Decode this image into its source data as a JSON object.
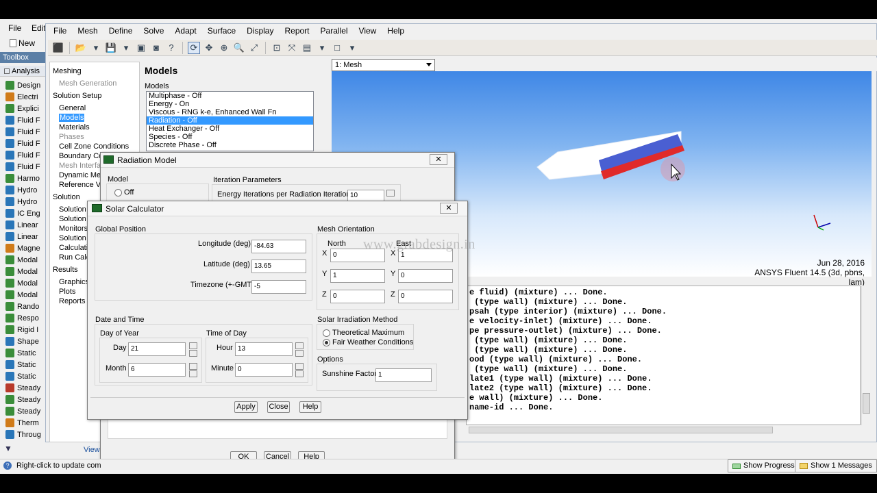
{
  "workbench": {
    "menu": [
      "File",
      "Edit"
    ],
    "new_label": "New",
    "toolbox_label": "Toolbox",
    "analysis_label": "Analysis",
    "toolbox_items": [
      {
        "label": "Design",
        "color": "#3a8d3a"
      },
      {
        "label": "Electri",
        "color": "#d07b1a"
      },
      {
        "label": "Explici",
        "color": "#3a8d3a"
      },
      {
        "label": "Fluid F",
        "color": "#2a76b8"
      },
      {
        "label": "Fluid F",
        "color": "#2a76b8"
      },
      {
        "label": "Fluid F",
        "color": "#2a76b8"
      },
      {
        "label": "Fluid F",
        "color": "#2a76b8"
      },
      {
        "label": "Fluid F",
        "color": "#2a76b8"
      },
      {
        "label": "Harmo",
        "color": "#3a8d3a"
      },
      {
        "label": "Hydro",
        "color": "#2a76b8"
      },
      {
        "label": "Hydro",
        "color": "#2a76b8"
      },
      {
        "label": "IC Eng",
        "color": "#2a76b8"
      },
      {
        "label": "Linear",
        "color": "#2a76b8"
      },
      {
        "label": "Linear",
        "color": "#2a76b8"
      },
      {
        "label": "Magne",
        "color": "#d07b1a"
      },
      {
        "label": "Modal",
        "color": "#3a8d3a"
      },
      {
        "label": "Modal",
        "color": "#3a8d3a"
      },
      {
        "label": "Modal",
        "color": "#3a8d3a"
      },
      {
        "label": "Modal",
        "color": "#3a8d3a"
      },
      {
        "label": "Rando",
        "color": "#3a8d3a"
      },
      {
        "label": "Respo",
        "color": "#3a8d3a"
      },
      {
        "label": "Rigid I",
        "color": "#3a8d3a"
      },
      {
        "label": "Shape",
        "color": "#2a76b8"
      },
      {
        "label": "Static",
        "color": "#3a8d3a"
      },
      {
        "label": "Static",
        "color": "#2a76b8"
      },
      {
        "label": "Static",
        "color": "#2a76b8"
      },
      {
        "label": "Steady",
        "color": "#b83a2a"
      },
      {
        "label": "Steady",
        "color": "#3a8d3a"
      },
      {
        "label": "Steady",
        "color": "#3a8d3a"
      },
      {
        "label": "Therm",
        "color": "#d07b1a"
      },
      {
        "label": "Throug",
        "color": "#2a76b8"
      }
    ],
    "view_link": "View",
    "status_text": "Right-click to update com",
    "show_progress": "Show Progress",
    "show_messages": "Show 1 Messages"
  },
  "fluent": {
    "menu": [
      "File",
      "Mesh",
      "Define",
      "Solve",
      "Adapt",
      "Surface",
      "Display",
      "Report",
      "Parallel",
      "View",
      "Help"
    ],
    "nav": {
      "meshing": "Meshing",
      "mesh_generation": "Mesh Generation",
      "solution_setup": "Solution Setup",
      "general": "General",
      "models": "Models",
      "materials": "Materials",
      "phases": "Phases",
      "cell_zone": "Cell Zone Conditions",
      "boundary": "Boundary Co",
      "mesh_interface": "Mesh Interfa",
      "dynamic_mesh": "Dynamic Mes",
      "reference": "Reference Va",
      "solution": "Solution",
      "sol_1": "Solution",
      "sol_2": "Solution",
      "monitors": "Monitors",
      "sol_3": "Solution",
      "calculation": "Calculati",
      "run_calc": "Run Calc",
      "results": "Results",
      "graphics": "Graphics",
      "plots": "Plots",
      "reports": "Reports"
    },
    "task_title": "Models",
    "models_label": "Models",
    "models": [
      "Multiphase - Off",
      "Energy - On",
      "Viscous - RNG k-e, Enhanced Wall Fn",
      "Radiation - Off",
      "Heat Exchanger - Off",
      "Species - Off",
      "Discrete Phase - Off"
    ],
    "selected_model_index": 3,
    "graphics_window": "1: Mesh",
    "date": "Jun 28, 2016",
    "version": "ANSYS Fluent 14.5 (3d, pbns, lam)",
    "console_lines": [
      "e fluid) (mixture) ... Done.",
      " (type wall) (mixture) ... Done.",
      "psah (type interior) (mixture) ... Done.",
      "e velocity-inlet) (mixture) ... Done.",
      "pe pressure-outlet) (mixture) ... Done.",
      " (type wall) (mixture) ... Done.",
      " (type wall) (mixture) ... Done.",
      "ood (type wall) (mixture) ... Done.",
      " (type wall) (mixture) ... Done.",
      "late1 (type wall) (mixture) ... Done.",
      "late2 (type wall) (mixture) ... Done.",
      "e wall) (mixture) ... Done.",
      "name-id ... Done."
    ]
  },
  "radiation_dialog": {
    "title": "Radiation Model",
    "model_label": "Model",
    "off_label": "Off",
    "iteration_params_label": "Iteration Parameters",
    "energy_iterations_label": "Energy Iterations per Radiation Iteration",
    "energy_iterations_value": "10",
    "ok": "OK",
    "cancel": "Cancel",
    "help": "Help"
  },
  "solar_dialog": {
    "title": "Solar Calculator",
    "global_position": "Global Position",
    "longitude_label": "Longitude (deg)",
    "longitude": "-84.63",
    "latitude_label": "Latitude (deg)",
    "latitude": "13.65",
    "timezone_label": "Timezone (+-GMT)",
    "timezone": "-5",
    "mesh_orientation": "Mesh Orientation",
    "north": "North",
    "east": "East",
    "north_x": "0",
    "north_y": "1",
    "north_z": "0",
    "east_x": "1",
    "east_y": "0",
    "east_z": "0",
    "x": "X",
    "y": "Y",
    "z": "Z",
    "date_time": "Date and Time",
    "day_of_year": "Day of Year",
    "day_label": "Day",
    "day": "21",
    "month_label": "Month",
    "month": "6",
    "time_of_day": "Time of Day",
    "hour_label": "Hour",
    "hour": "13",
    "minute_label": "Minute",
    "minute": "0",
    "irradiation_method": "Solar Irradiation Method",
    "theoretical_max": "Theoretical Maximum",
    "fair_weather": "Fair Weather Conditions",
    "options": "Options",
    "sunshine_factor_label": "Sunshine Factor",
    "sunshine_factor": "1",
    "apply": "Apply",
    "close": "Close",
    "help": "Help"
  },
  "watermark": "www.grabdesign.in"
}
